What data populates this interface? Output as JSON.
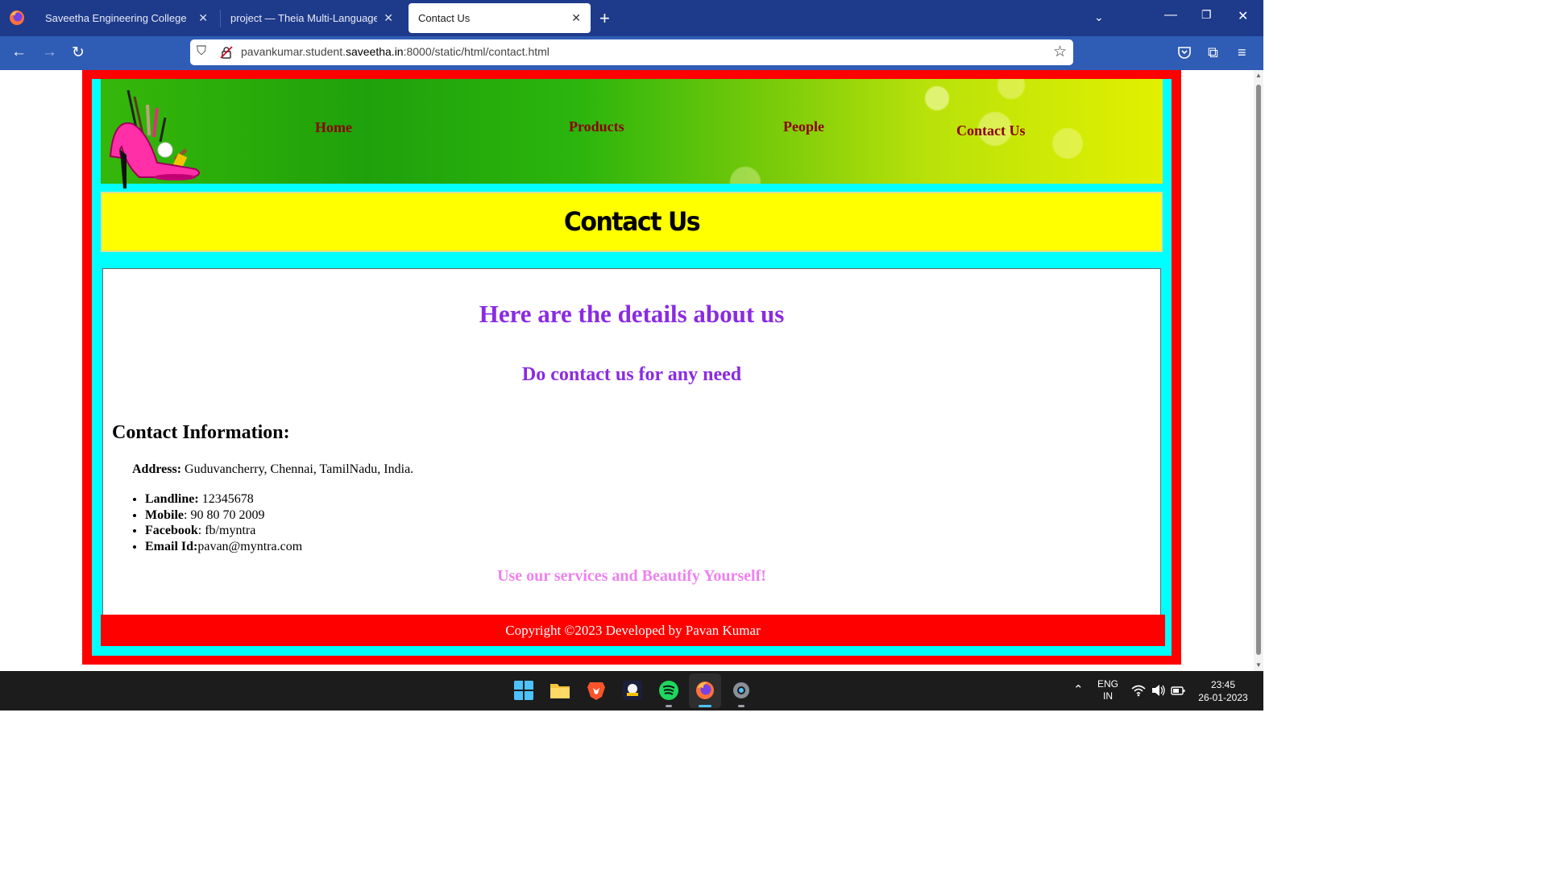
{
  "browser": {
    "tabs": [
      {
        "label": "Saveetha Engineering College",
        "active": false
      },
      {
        "label": "project — Theia Multi-Language Ex",
        "active": false
      },
      {
        "label": "Contact Us",
        "active": true
      }
    ],
    "url": {
      "prefix": "pavankumar.student.",
      "domain": "saveetha.in",
      "suffix": ":8000/static/html/contact.html"
    }
  },
  "site": {
    "nav": [
      "Home",
      "Products",
      "People",
      "Contact Us"
    ],
    "title": "Contact Us",
    "heading": "Here are the details about us",
    "subheading": "Do contact us for any need",
    "info_heading": "Contact Information:",
    "address": {
      "label": "Address:",
      "value": " Guduvancherry, Chennai, TamilNadu, India."
    },
    "contacts": [
      {
        "label": "Landline:",
        "value": " 12345678"
      },
      {
        "label": "Mobile",
        "value": ": 90 80 70 2009"
      },
      {
        "label": "Facebook",
        "value": ": fb/myntra"
      },
      {
        "label": "Email Id:",
        "value": "pavan@myntra.com"
      }
    ],
    "tagline": "Use our services and Beautify Yourself!",
    "footer": "Copyright ©2023 Developed by Pavan Kumar"
  },
  "colors": {
    "outer_border": "#ff0000",
    "frame": "#00ffff",
    "title_bg": "#ffff00",
    "heading": "#8a2be2",
    "nav_link": "#8b0000",
    "tagline": "#ee82ee"
  },
  "taskbar": {
    "language": "ENG",
    "region": "IN",
    "time": "23:45",
    "date": "26-01-2023"
  }
}
